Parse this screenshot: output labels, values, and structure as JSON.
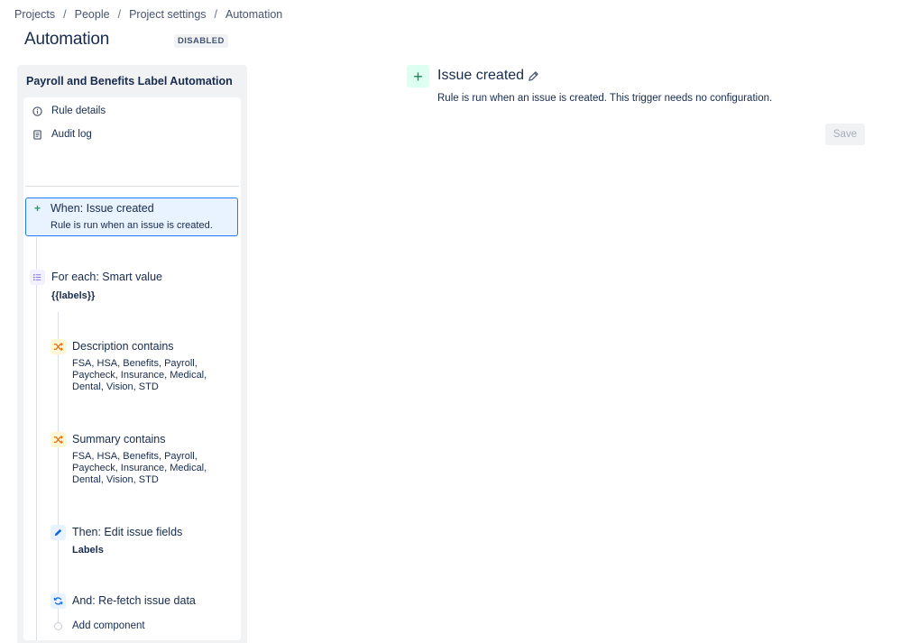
{
  "breadcrumbs": [
    "Projects",
    "People",
    "Project settings",
    "Automation"
  ],
  "breadcrumb_separator": "/",
  "page": {
    "title": "Automation",
    "status": "DISABLED"
  },
  "rule": {
    "name": "Payroll and Benefits Label Automation",
    "menu": [
      {
        "label": "Rule details",
        "icon": "info-icon"
      },
      {
        "label": "Audit log",
        "icon": "document-icon"
      }
    ],
    "trigger": {
      "title": "When: Issue created",
      "description": "Rule is run when an issue is created.",
      "icon": "plus-icon"
    },
    "branch": {
      "title": "For each: Smart value",
      "value": "{{labels}}",
      "icon": "list-icon"
    },
    "conditions": [
      {
        "title": "Description contains",
        "lines": [
          "FSA, HSA, Benefits, Payroll,",
          "Paycheck, Insurance, Medical,",
          "Dental, Vision, STD"
        ],
        "icon": "shuffle-icon"
      },
      {
        "title": "Summary contains",
        "lines": [
          "FSA, HSA, Benefits, Payroll,",
          "Paycheck, Insurance, Medical,",
          "Dental, Vision, STD"
        ],
        "icon": "shuffle-icon"
      }
    ],
    "action": {
      "title": "Then: Edit issue fields",
      "field": "Labels",
      "icon": "pencil-icon"
    },
    "refetch": {
      "title": "And: Re-fetch issue data",
      "icon": "refresh-icon"
    },
    "add_component": "Add component"
  },
  "detail": {
    "icon": "plus-icon",
    "title": "Issue created",
    "description": "Rule is run when an issue is created. This trigger needs no configuration.",
    "save_label": "Save"
  },
  "colors": {
    "accent": "#1D7AFC",
    "trigger_green": "#22A06B",
    "condition_orange": "#E56910",
    "panel_bg": "#F1F2F4"
  }
}
